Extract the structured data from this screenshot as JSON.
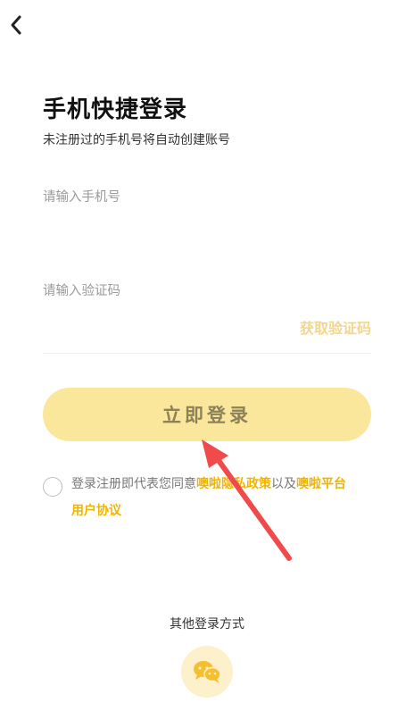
{
  "header": {
    "back_icon": "chevron-left-icon"
  },
  "page": {
    "title": "手机快捷登录",
    "subtitle": "未注册过的手机号将自动创建账号"
  },
  "form": {
    "phone_placeholder": "请输入手机号",
    "phone_value": "",
    "code_placeholder": "请输入验证码",
    "code_value": "",
    "get_code_label": "获取验证码",
    "login_label": "立即登录"
  },
  "agreement": {
    "checked": false,
    "prefix": "登录注册即代表您同意",
    "privacy_link": "噢啦隐私政策",
    "middle": "以及",
    "user_link_part1": "噢啦平台",
    "user_link_part2": "用户协议"
  },
  "other_login": {
    "title": "其他登录方式",
    "wechat_icon": "wechat-icon"
  },
  "annotation": {
    "arrow_icon": "red-arrow-annotation"
  },
  "colors": {
    "accent": "#f0b400",
    "button_bg": "#fbe79b",
    "button_text": "#8c8159",
    "get_code_text": "#f2d68f",
    "wechat_bg": "#fdf1cc",
    "arrow_red": "#f04a4a"
  }
}
